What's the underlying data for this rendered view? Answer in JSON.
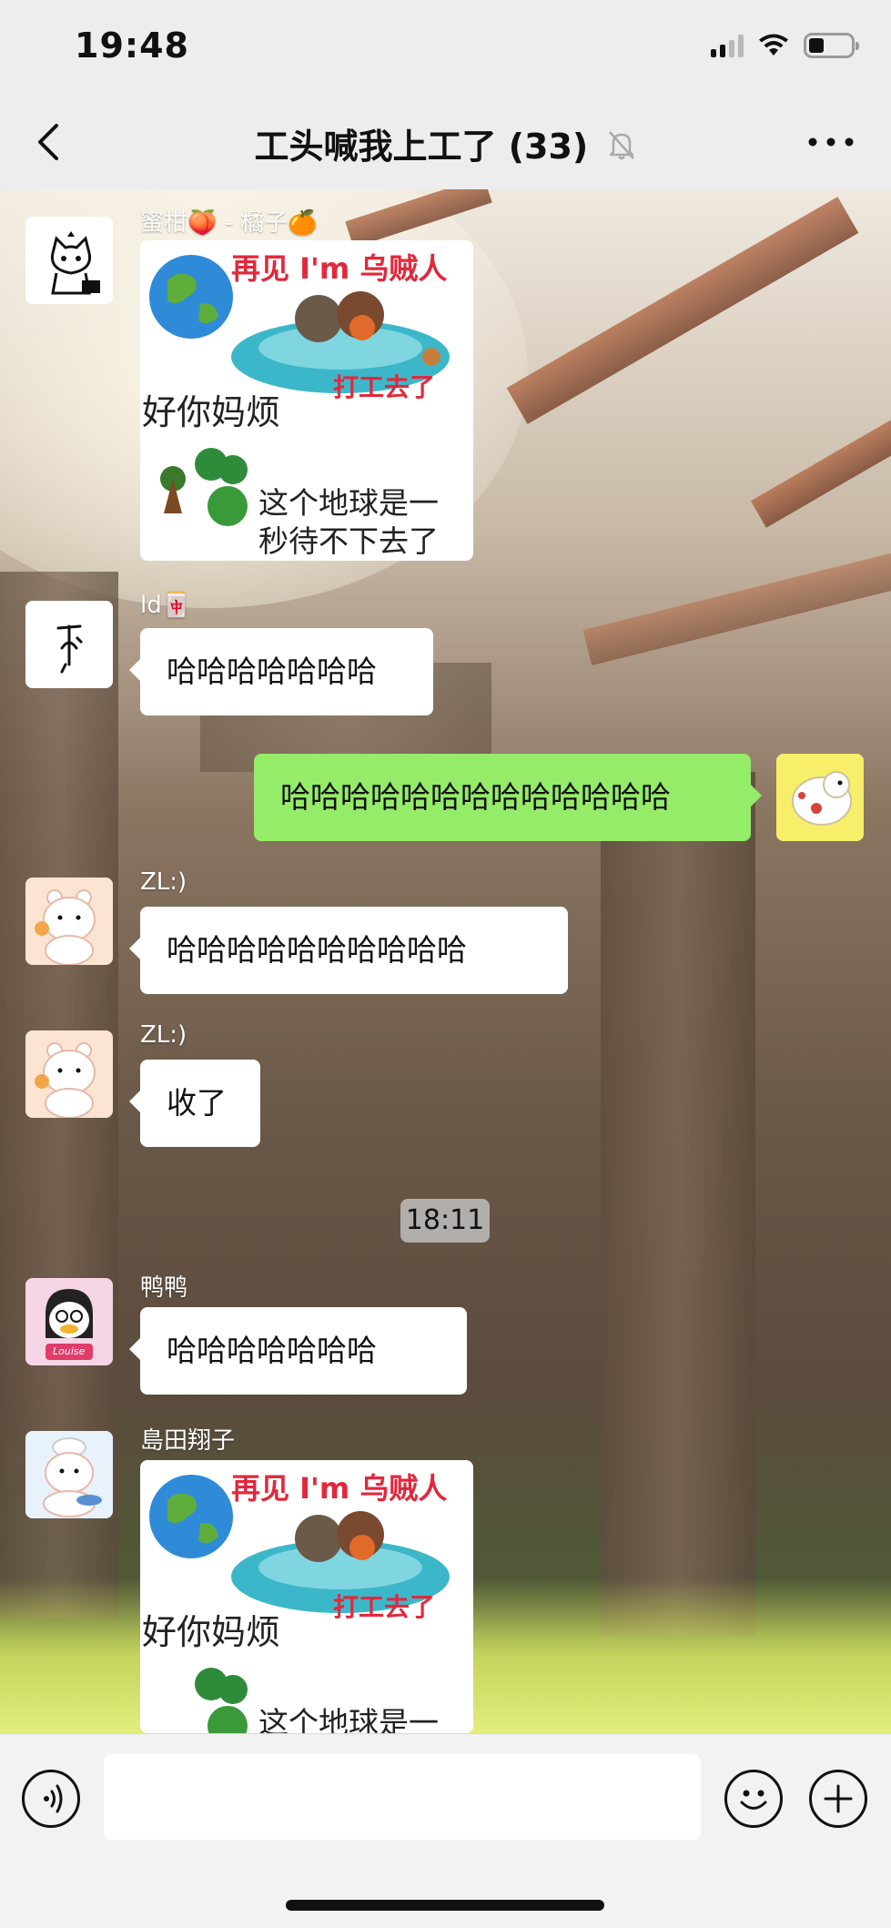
{
  "status_bar": {
    "time": "19:48"
  },
  "nav": {
    "back_icon": "chevron-left-icon",
    "title": "工头喊我上工了 (33)",
    "mute_icon": "muted-bell-icon",
    "more_icon": "ellipsis-icon"
  },
  "messages": [
    {
      "sender": "蜜柑🍑 - 橘子🍊",
      "type": "sticker",
      "sticker": {
        "top_text": "再见 I'm 乌贼人",
        "middle_text": "好你妈烦",
        "red_text": "打工去了",
        "bottom_line1": "这个地球是一",
        "bottom_line2": "秒待不下去了"
      }
    },
    {
      "sender": "ld🀄",
      "type": "text",
      "text": "哈哈哈哈哈哈哈"
    },
    {
      "sender": "",
      "type": "text",
      "from_me": true,
      "text": "哈哈哈哈哈哈哈哈哈哈哈哈哈"
    },
    {
      "sender": "ZL:)",
      "type": "text",
      "text": "哈哈哈哈哈哈哈哈哈哈"
    },
    {
      "sender": "ZL:)",
      "type": "text",
      "text": "收了"
    },
    {
      "sender": "鸭鸭",
      "type": "text",
      "text": "哈哈哈哈哈哈哈"
    },
    {
      "sender": "島田翔子",
      "type": "sticker",
      "sticker": {
        "top_text": "再见 I'm 乌贼人",
        "middle_text": "好你妈烦",
        "red_text": "打工去了",
        "bottom_line1": "这个地球是一",
        "bottom_line2": ""
      }
    }
  ],
  "timestamp_chip": "18:11",
  "avatars": {
    "m1": "cat-doodle",
    "m2": "sketch-figure",
    "me": "cartoon-animal",
    "m4": "pink-bear",
    "m5": "pink-bear",
    "m6": "duck-girl-louise",
    "m7": "bear-chef"
  },
  "avatar_label_louise": "Louise",
  "input_bar": {
    "voice_icon": "voice-icon",
    "emoji_icon": "emoji-icon",
    "plus_icon": "plus-icon",
    "input_value": ""
  },
  "colors": {
    "my_bubble": "#95ec69",
    "sticker_red": "#e2283c",
    "bar_bg": "#ededed"
  }
}
